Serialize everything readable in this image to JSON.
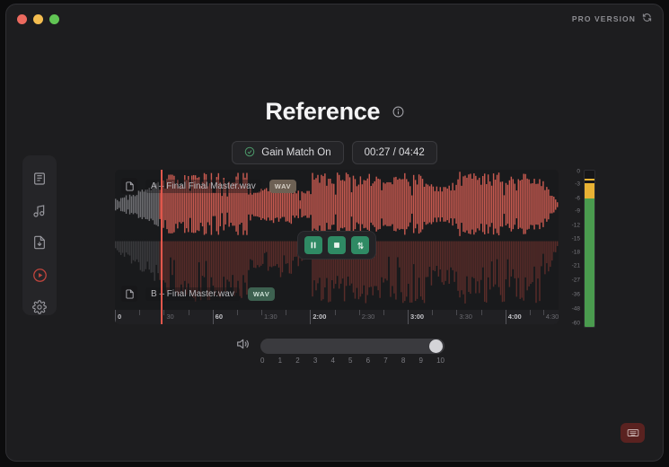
{
  "window": {
    "traffic_lights": [
      {
        "name": "close",
        "color": "#ec6a5f"
      },
      {
        "name": "minimize",
        "color": "#f4bd50"
      },
      {
        "name": "maximize",
        "color": "#61c554"
      }
    ],
    "pro_label": "PRO VERSION",
    "refresh_icon": "refresh-icon"
  },
  "header": {
    "title": "Reference",
    "info_icon": "info-icon",
    "gain_match": {
      "label": "Gain Match On",
      "icon": "check-circle-icon",
      "icon_color": "#4c9a6a"
    },
    "time": {
      "label": "00:27 / 04:42",
      "current": "00:27",
      "total": "04:42"
    }
  },
  "sidebar": {
    "items": [
      {
        "name": "sidebar-item-library",
        "icon": "book-icon",
        "active": false
      },
      {
        "name": "sidebar-item-music",
        "icon": "music-note-icon",
        "active": false
      },
      {
        "name": "sidebar-item-export",
        "icon": "file-download-icon",
        "active": false
      },
      {
        "name": "sidebar-item-player",
        "icon": "play-circle-icon",
        "active": true
      },
      {
        "name": "sidebar-item-settings",
        "icon": "gear-icon",
        "active": false
      }
    ],
    "active_color": "#c0453d"
  },
  "player": {
    "tracks": [
      {
        "id": "A",
        "name": "A – Final Final Master.wav",
        "format_badge": "WAV",
        "badge_color": "#6d6154",
        "wave_color": "#c85a50",
        "active": true
      },
      {
        "id": "B",
        "name": "B – Final Master.wav",
        "format_badge": "WAV",
        "badge_color": "#3d6150",
        "wave_color": "#5a2c29",
        "active": false
      }
    ],
    "playhead_color": "#e2574c",
    "playhead_position_pct": 10.3,
    "transport": [
      {
        "name": "pause-button",
        "icon": "pause-icon",
        "label": "Pause"
      },
      {
        "name": "stop-button",
        "icon": "stop-icon",
        "label": "Stop"
      },
      {
        "name": "swap-button",
        "icon": "swap-arrows-icon",
        "label": "Swap A/B"
      }
    ],
    "transport_color": "#2f8a64"
  },
  "ruler": {
    "ticks": [
      {
        "label": "0",
        "pct": 0,
        "major": true
      },
      {
        "label": "",
        "pct": 5.5,
        "major": false
      },
      {
        "label": "30",
        "pct": 11,
        "major": false
      },
      {
        "label": "",
        "pct": 16.5,
        "major": false
      },
      {
        "label": "60",
        "pct": 22,
        "major": true
      },
      {
        "label": "",
        "pct": 27.5,
        "major": false
      },
      {
        "label": "1:30",
        "pct": 33,
        "major": false
      },
      {
        "label": "",
        "pct": 38.5,
        "major": false
      },
      {
        "label": "2:00",
        "pct": 44,
        "major": true
      },
      {
        "label": "",
        "pct": 49.5,
        "major": false
      },
      {
        "label": "2:30",
        "pct": 55,
        "major": false
      },
      {
        "label": "",
        "pct": 60.5,
        "major": false
      },
      {
        "label": "3:00",
        "pct": 66,
        "major": true
      },
      {
        "label": "",
        "pct": 71.5,
        "major": false
      },
      {
        "label": "3:30",
        "pct": 77,
        "major": false
      },
      {
        "label": "",
        "pct": 82.5,
        "major": false
      },
      {
        "label": "4:00",
        "pct": 88,
        "major": true
      },
      {
        "label": "",
        "pct": 93.5,
        "major": false
      },
      {
        "label": "4:30",
        "pct": 96.5,
        "major": false
      }
    ]
  },
  "meter": {
    "scale": [
      {
        "label": "0",
        "pct": 1
      },
      {
        "label": "-3",
        "pct": 9
      },
      {
        "label": "-6",
        "pct": 18
      },
      {
        "label": "-9",
        "pct": 26
      },
      {
        "label": "-12",
        "pct": 35
      },
      {
        "label": "-15",
        "pct": 44
      },
      {
        "label": "-18",
        "pct": 52
      },
      {
        "label": "-21",
        "pct": 61
      },
      {
        "label": "-27",
        "pct": 70
      },
      {
        "label": "-36",
        "pct": 79
      },
      {
        "label": "-48",
        "pct": 88
      },
      {
        "label": "-60",
        "pct": 97
      }
    ],
    "green_color": "#4a9b4e",
    "yellow_color": "#e8b234",
    "level_db": -2,
    "peak_db": -1
  },
  "volume": {
    "icon": "speaker-icon",
    "value": 10,
    "min": 0,
    "max": 10,
    "scale": [
      "0",
      "1",
      "2",
      "3",
      "4",
      "5",
      "6",
      "7",
      "8",
      "9",
      "10"
    ]
  },
  "fab": {
    "name": "keyboard-shortcuts-button",
    "icon": "keyboard-icon",
    "color": "#5a2220"
  }
}
